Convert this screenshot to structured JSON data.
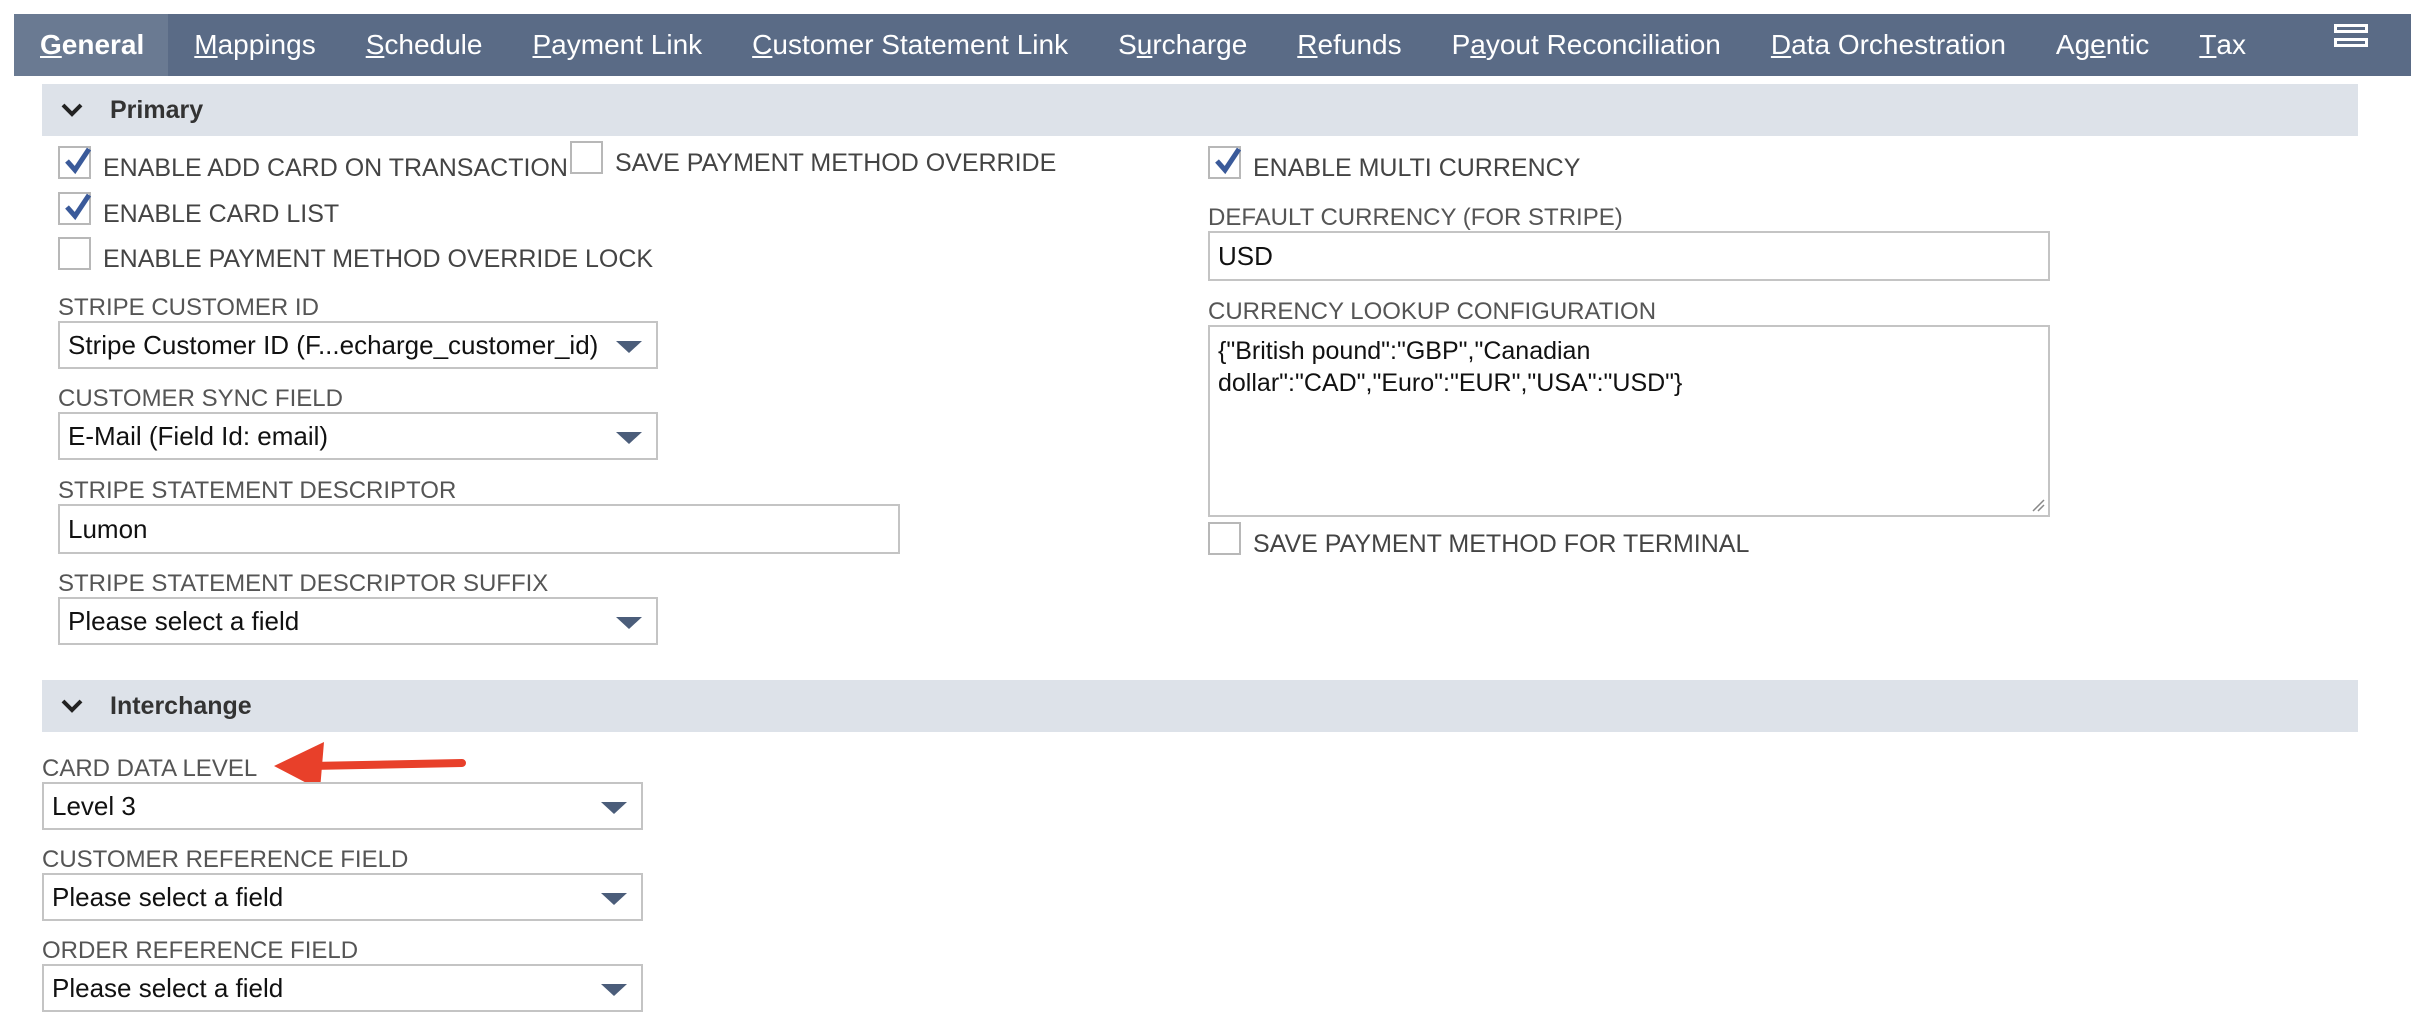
{
  "tabs": [
    {
      "pre": "",
      "u": "G",
      "post": "eneral",
      "active": true
    },
    {
      "pre": "",
      "u": "M",
      "post": "appings"
    },
    {
      "pre": "",
      "u": "S",
      "post": "chedule"
    },
    {
      "pre": "",
      "u": "P",
      "post": "ayment Link"
    },
    {
      "pre": "",
      "u": "C",
      "post": "ustomer Statement Link"
    },
    {
      "pre": "S",
      "u": "u",
      "post": "rcharge"
    },
    {
      "pre": "",
      "u": "R",
      "post": "efunds"
    },
    {
      "pre": "P",
      "u": "a",
      "post": "yout Reconciliation"
    },
    {
      "pre": "",
      "u": "D",
      "post": "ata Orchestration"
    },
    {
      "pre": "Ag",
      "u": "e",
      "post": "ntic"
    },
    {
      "pre": "",
      "u": "T",
      "post": "ax"
    }
  ],
  "primary": {
    "title": "Primary",
    "enable_add_card": {
      "label": "ENABLE ADD CARD ON TRANSACTION",
      "checked": true
    },
    "save_override": {
      "label": "SAVE PAYMENT METHOD OVERRIDE",
      "checked": false
    },
    "enable_card_list": {
      "label": "ENABLE CARD LIST",
      "checked": true
    },
    "override_lock": {
      "label": "ENABLE PAYMENT METHOD OVERRIDE LOCK",
      "checked": false
    },
    "stripe_customer_id": {
      "label": "STRIPE CUSTOMER ID",
      "value": "Stripe Customer ID (F...echarge_customer_id)"
    },
    "customer_sync": {
      "label": "CUSTOMER SYNC FIELD",
      "value": "E-Mail (Field Id: email)"
    },
    "descriptor": {
      "label": "STRIPE STATEMENT DESCRIPTOR",
      "value": "Lumon"
    },
    "descriptor_suffix": {
      "label": "STRIPE STATEMENT DESCRIPTOR SUFFIX",
      "value": "Please select a field"
    },
    "multi_currency": {
      "label": "ENABLE MULTI CURRENCY",
      "checked": true
    },
    "default_currency": {
      "label": "DEFAULT CURRENCY (FOR STRIPE)",
      "value": "USD"
    },
    "currency_lookup": {
      "label": "CURRENCY LOOKUP CONFIGURATION",
      "line1": "{\"British pound\":\"GBP\",\"Canadian",
      "line2": "dollar\":\"CAD\",\"Euro\":\"EUR\",\"USA\":\"USD\"}"
    },
    "save_terminal": {
      "label": "SAVE PAYMENT METHOD FOR TERMINAL",
      "checked": false
    }
  },
  "interchange": {
    "title": "Interchange",
    "card_data_level": {
      "label": "CARD DATA LEVEL",
      "value": "Level 3"
    },
    "customer_ref": {
      "label": "CUSTOMER REFERENCE FIELD",
      "value": "Please select a field"
    },
    "order_ref": {
      "label": "ORDER REFERENCE FIELD",
      "value": "Please select a field"
    }
  },
  "colors": {
    "tabbar": "#5a6b86",
    "section": "#dde2e9",
    "check": "#3a5a9a",
    "arrow": "#e8402a"
  }
}
